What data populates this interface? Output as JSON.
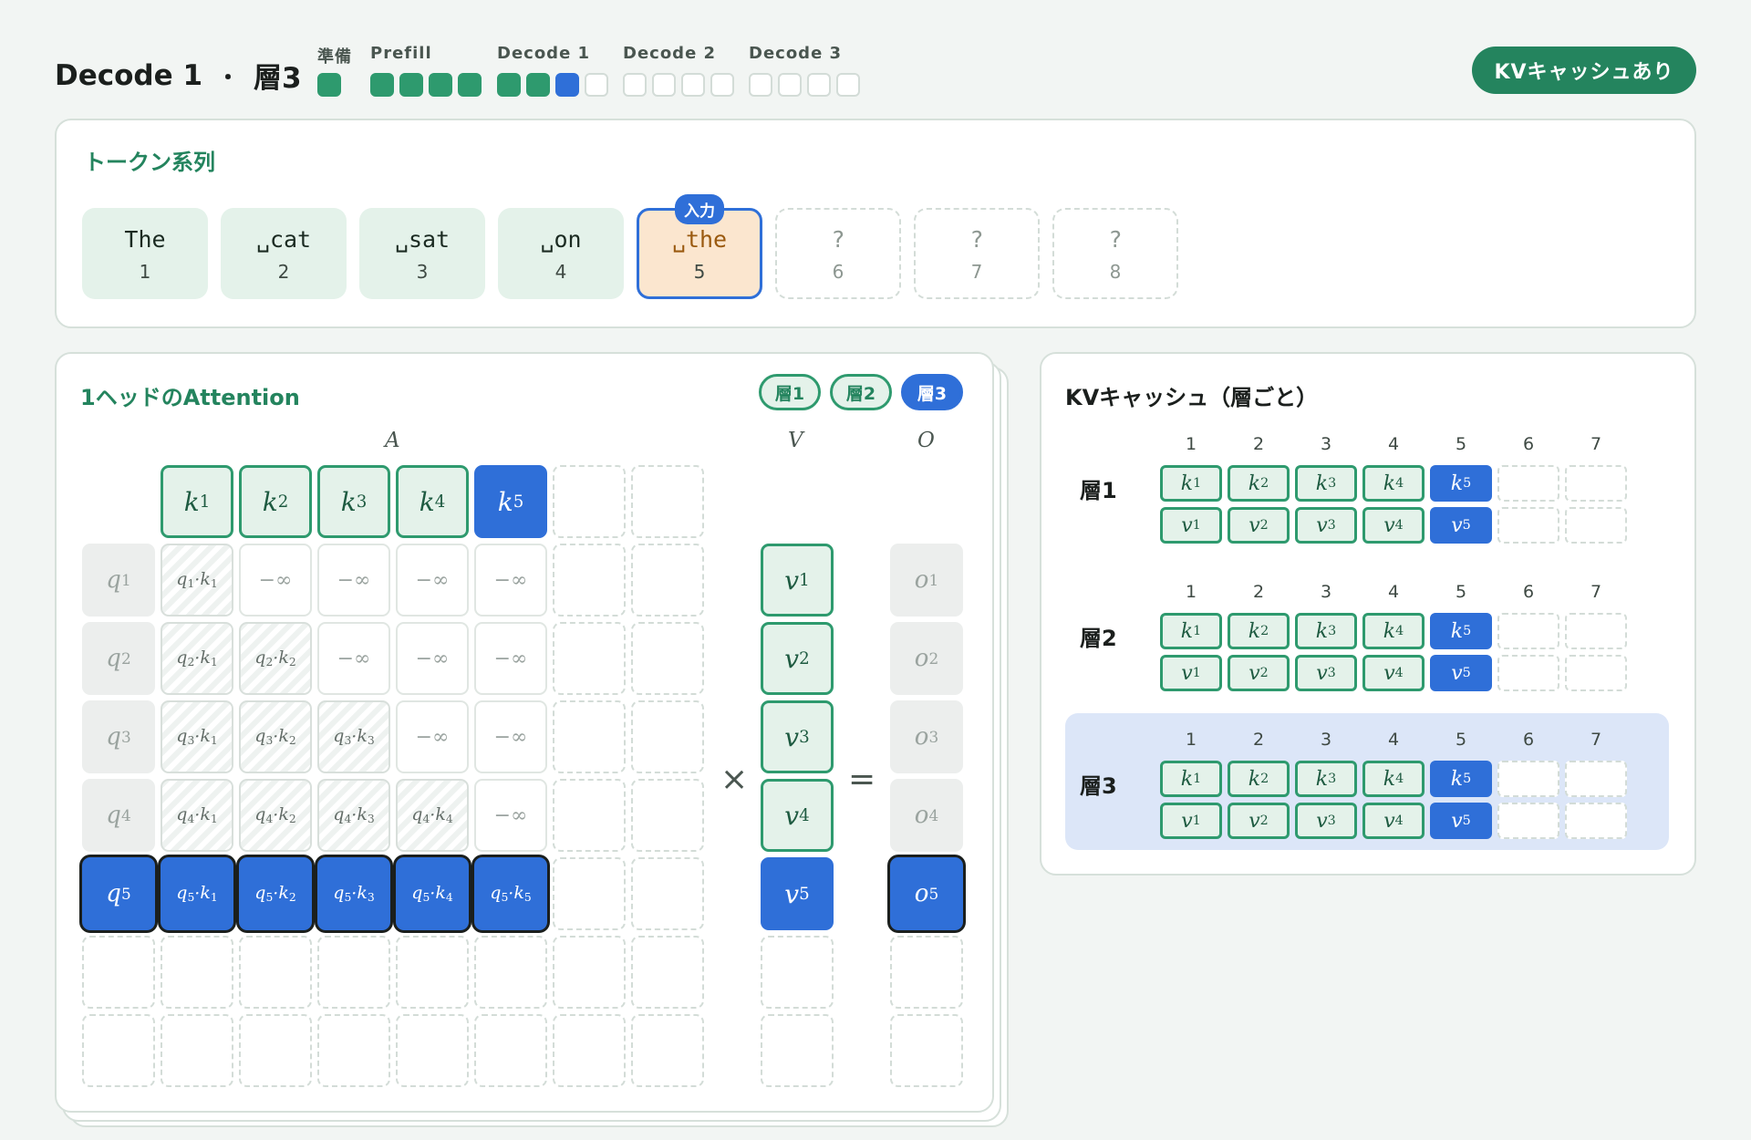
{
  "header": {
    "title_phase": "Decode 1",
    "separator": "・",
    "title_layer": "層3",
    "kv_badge": "KVキャッシュあり"
  },
  "progress": {
    "phases": [
      {
        "label": "準備",
        "states": [
          "done"
        ]
      },
      {
        "label": "Prefill",
        "states": [
          "done",
          "done",
          "done",
          "done"
        ]
      },
      {
        "label": "Decode 1",
        "states": [
          "done",
          "done",
          "current",
          "todo"
        ]
      },
      {
        "label": "Decode 2",
        "states": [
          "todo",
          "todo",
          "todo",
          "todo"
        ]
      },
      {
        "label": "Decode 3",
        "states": [
          "todo",
          "todo",
          "todo",
          "todo"
        ]
      }
    ]
  },
  "tokens": {
    "title": "トークン系列",
    "input_tag": "入力",
    "items": [
      {
        "text": "The",
        "index": "1",
        "state": "done"
      },
      {
        "text": "␣cat",
        "index": "2",
        "state": "done"
      },
      {
        "text": "␣sat",
        "index": "3",
        "state": "done"
      },
      {
        "text": "␣on",
        "index": "4",
        "state": "done"
      },
      {
        "text": "␣the",
        "index": "5",
        "state": "input"
      },
      {
        "text": "?",
        "index": "6",
        "state": "future"
      },
      {
        "text": "?",
        "index": "7",
        "state": "future"
      },
      {
        "text": "?",
        "index": "8",
        "state": "future"
      }
    ]
  },
  "attention": {
    "title": "1ヘッドのAttention",
    "layer_pills": [
      "層1",
      "層2",
      "層3"
    ],
    "active_layer": "層3",
    "label_a": "A",
    "label_v": "V",
    "label_o": "O",
    "times": "×",
    "equals": "=",
    "neg_inf": "−∞",
    "keys": [
      "k|1",
      "k|2",
      "k|3",
      "k|4",
      "k|5"
    ],
    "queries": [
      "q|1",
      "q|2",
      "q|3",
      "q|4",
      "q|5"
    ],
    "values": [
      "v|1",
      "v|2",
      "v|3",
      "v|4",
      "v|5"
    ],
    "outputs": [
      "o|1",
      "o|2",
      "o|3",
      "o|4",
      "o|5"
    ],
    "new_row_index": 5,
    "seq_len": 5,
    "grid_rows": 7,
    "grid_cols": 7
  },
  "kv_cache": {
    "title": "KVキャッシュ（層ごと）",
    "column_numbers": [
      "1",
      "2",
      "3",
      "4",
      "5",
      "6",
      "7"
    ],
    "filled": 5,
    "layers": [
      {
        "name": "層1",
        "active": false
      },
      {
        "name": "層2",
        "active": false
      },
      {
        "name": "層3",
        "active": true
      }
    ]
  },
  "colors": {
    "accent_green": "#2e9a6e",
    "accent_blue": "#2f6fd8",
    "input_token_bg": "#fbe6cf",
    "active_layer_bg": "#dce6f8"
  }
}
